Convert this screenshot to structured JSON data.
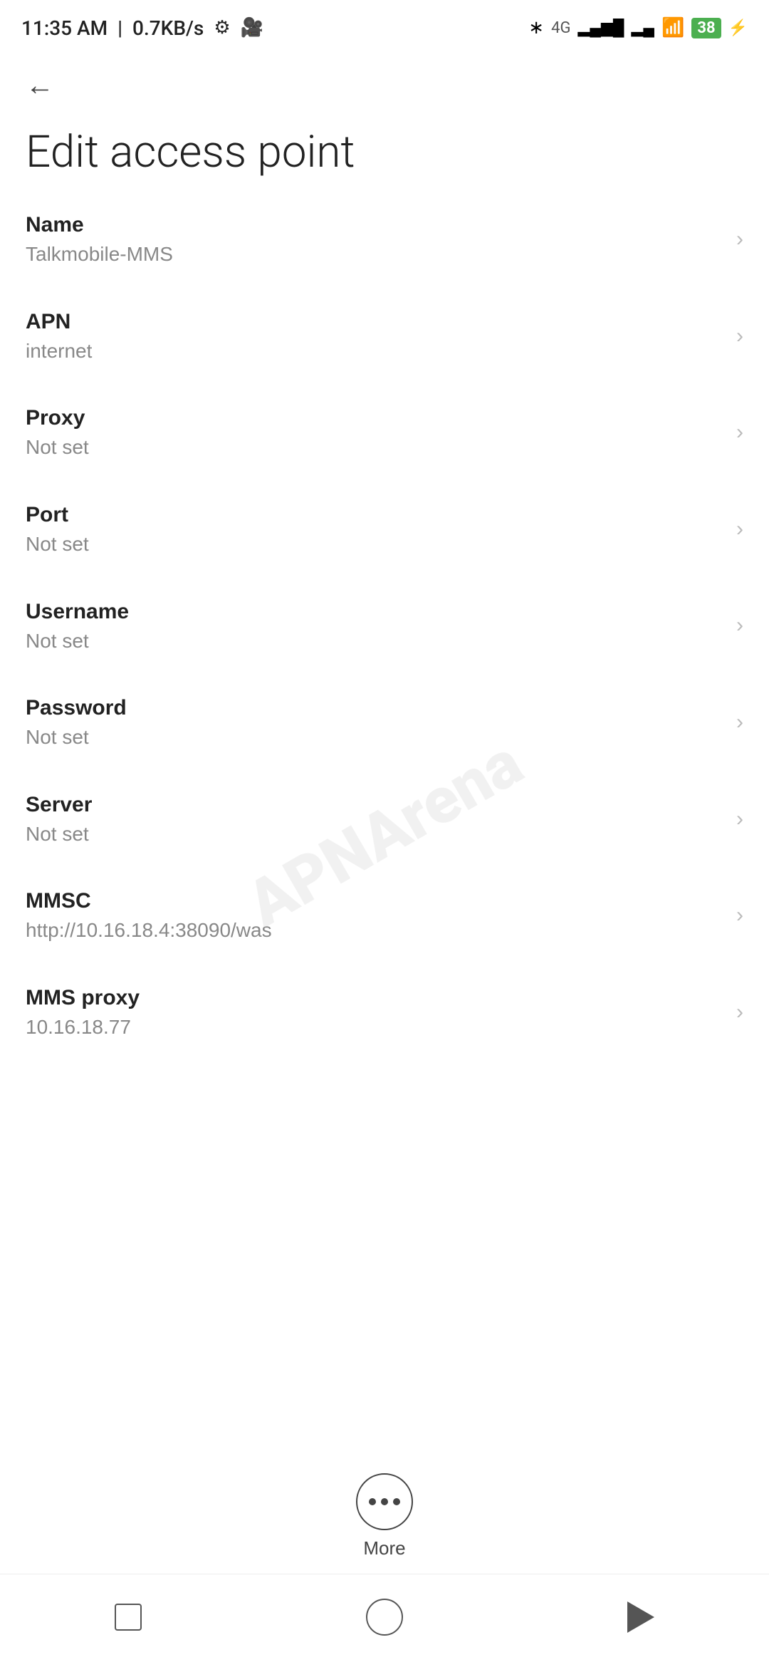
{
  "statusBar": {
    "time": "11:35 AM",
    "speed": "0.7KB/s"
  },
  "toolbar": {
    "backLabel": "←"
  },
  "page": {
    "title": "Edit access point"
  },
  "settings": [
    {
      "id": "name",
      "label": "Name",
      "value": "Talkmobile-MMS"
    },
    {
      "id": "apn",
      "label": "APN",
      "value": "internet"
    },
    {
      "id": "proxy",
      "label": "Proxy",
      "value": "Not set"
    },
    {
      "id": "port",
      "label": "Port",
      "value": "Not set"
    },
    {
      "id": "username",
      "label": "Username",
      "value": "Not set"
    },
    {
      "id": "password",
      "label": "Password",
      "value": "Not set"
    },
    {
      "id": "server",
      "label": "Server",
      "value": "Not set"
    },
    {
      "id": "mmsc",
      "label": "MMSC",
      "value": "http://10.16.18.4:38090/was"
    },
    {
      "id": "mms-proxy",
      "label": "MMS proxy",
      "value": "10.16.18.77"
    }
  ],
  "more": {
    "label": "More"
  },
  "watermark": "APNArena"
}
